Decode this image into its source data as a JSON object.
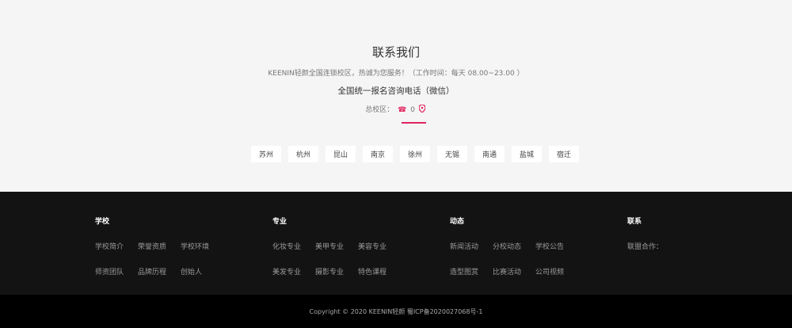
{
  "contact": {
    "title": "联系我们",
    "description": "KEENIN轻颜全国连锁校区，热诚为您服务！（工作时间：每天 08.00~23.00 ）",
    "phone_title": "全国统一报名咨询电话（微信）",
    "campus_label": "总校区：",
    "phone_value": "0",
    "phone_icon": "phone-icon",
    "location_icon": "location-pin-icon",
    "accent_color": "#e0245e"
  },
  "cities": [
    "苏州",
    "杭州",
    "昆山",
    "南京",
    "徐州",
    "无锡",
    "南通",
    "盐城",
    "宿迁"
  ],
  "footer": {
    "columns": [
      {
        "title": "学校",
        "rows": [
          [
            "学校简介",
            "荣誉资质",
            "学校环境"
          ],
          [
            "师资团队",
            "品牌历程",
            "创始人"
          ]
        ]
      },
      {
        "title": "专业",
        "rows": [
          [
            "化妆专业",
            "美甲专业",
            "美容专业"
          ],
          [
            "美发专业",
            "摄影专业",
            "特色课程"
          ]
        ]
      },
      {
        "title": "动态",
        "rows": [
          [
            "新闻活动",
            "分校动态",
            "学校公告"
          ],
          [
            "造型图赏",
            "比赛活动",
            "公司视频"
          ]
        ]
      },
      {
        "title": "联系",
        "rows": [
          [
            "联盟合作："
          ]
        ]
      }
    ],
    "copyright": "Copyright © 2020 KEENIN轻颜  蜀ICP备2020027068号-1"
  }
}
